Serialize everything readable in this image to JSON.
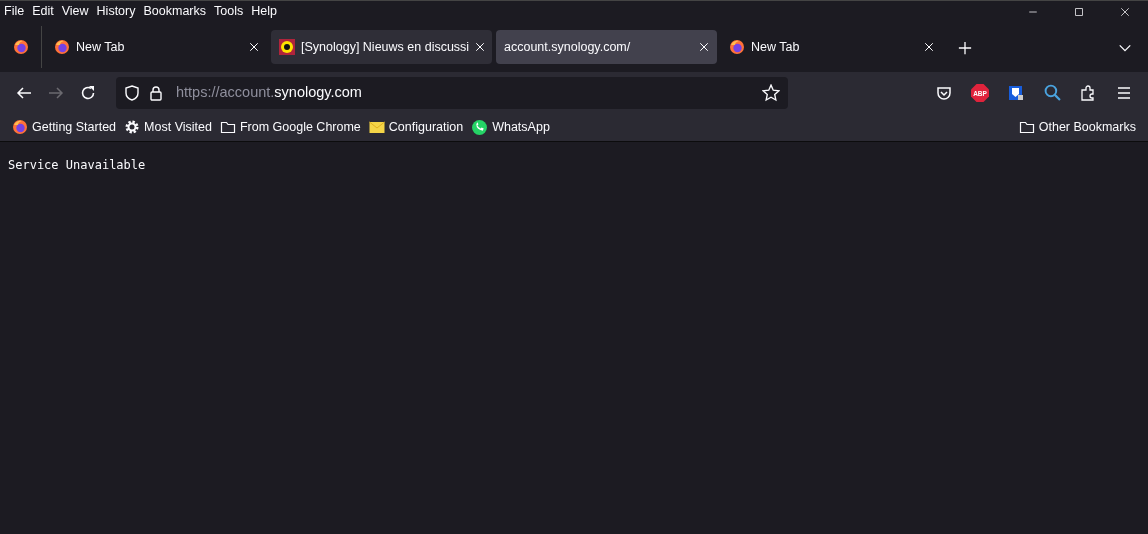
{
  "menu": [
    "File",
    "Edit",
    "View",
    "History",
    "Bookmarks",
    "Tools",
    "Help"
  ],
  "tabs": [
    {
      "title": "New Tab",
      "kind": "firefox",
      "selected": false,
      "hovered": false
    },
    {
      "title": "[Synology] Nieuws en discussi",
      "kind": "synology",
      "selected": false,
      "hovered": true
    },
    {
      "title": "account.synology.com/",
      "kind": "plain",
      "selected": true,
      "hovered": false
    },
    {
      "title": "New Tab",
      "kind": "firefox",
      "selected": false,
      "hovered": false
    }
  ],
  "nav": {
    "back_disabled": false,
    "forward_disabled": true
  },
  "address": {
    "scheme_prefix": "https://account.",
    "domain": "synology.com"
  },
  "extensions": [
    {
      "kind": "pocket"
    },
    {
      "kind": "abp",
      "label": "ABP"
    },
    {
      "kind": "bitwarden"
    },
    {
      "kind": "search"
    },
    {
      "kind": "puzzle"
    },
    {
      "kind": "menu"
    }
  ],
  "bookmarks": [
    {
      "label": "Getting Started",
      "kind": "firefox"
    },
    {
      "label": "Most Visited",
      "kind": "gear"
    },
    {
      "label": "From Google Chrome",
      "kind": "folder"
    },
    {
      "label": "Configuration",
      "kind": "envelope"
    },
    {
      "label": "WhatsApp",
      "kind": "chat"
    }
  ],
  "other_bookmarks": {
    "label": "Other Bookmarks"
  },
  "page": {
    "text": "Service Unavailable"
  }
}
